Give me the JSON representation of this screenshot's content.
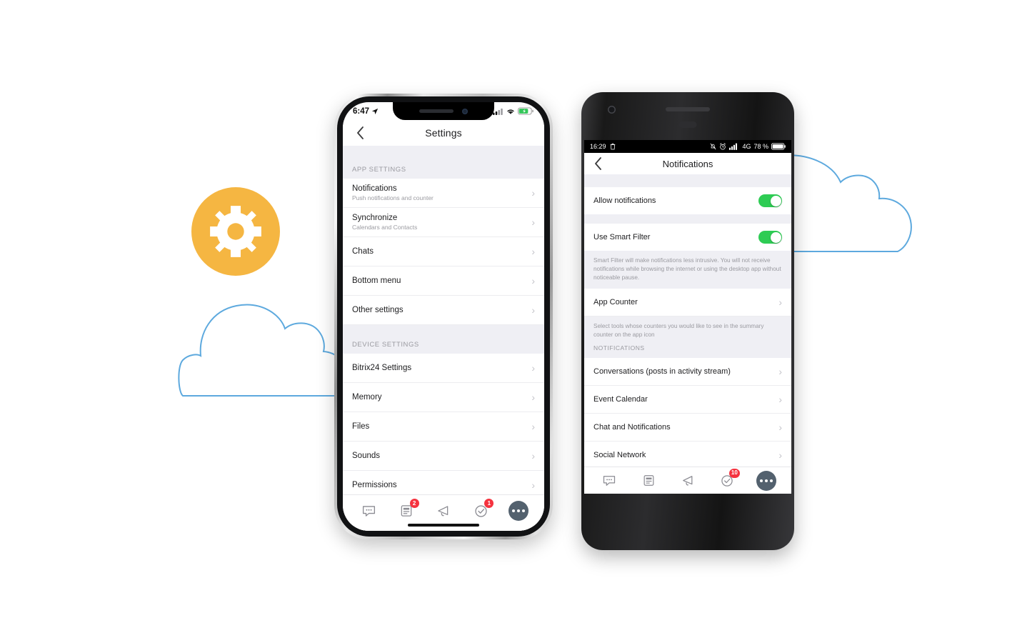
{
  "decor": {
    "gear_icon": "gear-icon",
    "gear_color": "#F5B642",
    "cloud_color": "#5DA9DE",
    "clouds": [
      "cloud-outline-left",
      "cloud-outline-right"
    ]
  },
  "iphone": {
    "status": {
      "time": "6:47",
      "location_icon": "location-arrow-icon",
      "signal_icon": "cellular-signal-icon",
      "wifi_icon": "wifi-icon",
      "battery_icon": "battery-charging-icon",
      "battery_color": "#34C759"
    },
    "navbar": {
      "back_icon": "chevron-left-icon",
      "title": "Settings"
    },
    "sections": [
      {
        "header": "APP SETTINGS",
        "rows": [
          {
            "title": "Notifications",
            "sub": "Push notifications and counter",
            "chevron": "chevron-right-icon"
          },
          {
            "title": "Synchronize",
            "sub": "Calendars and Contacts",
            "chevron": "chevron-right-icon"
          },
          {
            "title": "Chats",
            "sub": "",
            "chevron": "chevron-right-icon"
          },
          {
            "title": "Bottom menu",
            "sub": "",
            "chevron": "chevron-right-icon"
          },
          {
            "title": "Other settings",
            "sub": "",
            "chevron": "chevron-right-icon"
          }
        ]
      },
      {
        "header": "DEVICE SETTINGS",
        "rows": [
          {
            "title": "Bitrix24 Settings",
            "sub": "",
            "chevron": "chevron-right-icon"
          },
          {
            "title": "Memory",
            "sub": "",
            "chevron": "chevron-right-icon"
          },
          {
            "title": "Files",
            "sub": "",
            "chevron": "chevron-right-icon"
          },
          {
            "title": "Sounds",
            "sub": "",
            "chevron": "chevron-right-icon"
          },
          {
            "title": "Permissions",
            "sub": "",
            "chevron": "chevron-right-icon"
          }
        ]
      }
    ],
    "tabbar": [
      {
        "icon": "chat-bubble-icon",
        "badge": ""
      },
      {
        "icon": "feed-document-icon",
        "badge": "2"
      },
      {
        "icon": "bell-icon",
        "badge": ""
      },
      {
        "icon": "check-circle-icon",
        "badge": "1"
      },
      {
        "icon": "more-ellipsis-icon",
        "badge": ""
      }
    ],
    "badge_color": "#F5333F",
    "more_color": "#53616E"
  },
  "android": {
    "status": {
      "time": "16:29",
      "trash_icon": "trash-icon",
      "mute_icon": "bell-muted-icon",
      "alarm_icon": "alarm-clock-icon",
      "signal_icon": "cellular-signal-icon",
      "network": "4G",
      "battery_percent": "78 %",
      "battery_icon": "battery-icon"
    },
    "navbar": {
      "back_icon": "chevron-left-icon",
      "title": "Notifications"
    },
    "toggles": [
      {
        "label": "Allow notifications",
        "state": "on"
      },
      {
        "label": "Use Smart Filter",
        "state": "on"
      }
    ],
    "smart_filter_note": "Smart Filter will make notifications less intrusive. You will not receive notifications while browsing the internet or using the desktop app without noticeable pause.",
    "app_counter": {
      "title": "App Counter",
      "chevron": "chevron-right-icon"
    },
    "app_counter_note": "Select tools whose counters you would like to see in the summary counter on the app icon",
    "notifications_header": "NOTIFICATIONS",
    "notification_rows": [
      {
        "title": "Conversations (posts in activity stream)",
        "chevron": "chevron-right-icon"
      },
      {
        "title": "Event Calendar",
        "chevron": "chevron-right-icon"
      },
      {
        "title": "Chat and Notifications",
        "chevron": "chevron-right-icon"
      },
      {
        "title": "Social Network",
        "chevron": "chevron-right-icon"
      }
    ],
    "tabbar": [
      {
        "icon": "chat-bubble-icon",
        "badge": ""
      },
      {
        "icon": "feed-document-icon",
        "badge": ""
      },
      {
        "icon": "bell-icon",
        "badge": ""
      },
      {
        "icon": "check-circle-icon",
        "badge": "10"
      },
      {
        "icon": "more-ellipsis-icon",
        "badge": ""
      }
    ],
    "toggle_color": "#2ECC54",
    "badge_color": "#F5333F",
    "more_color": "#53616E"
  }
}
